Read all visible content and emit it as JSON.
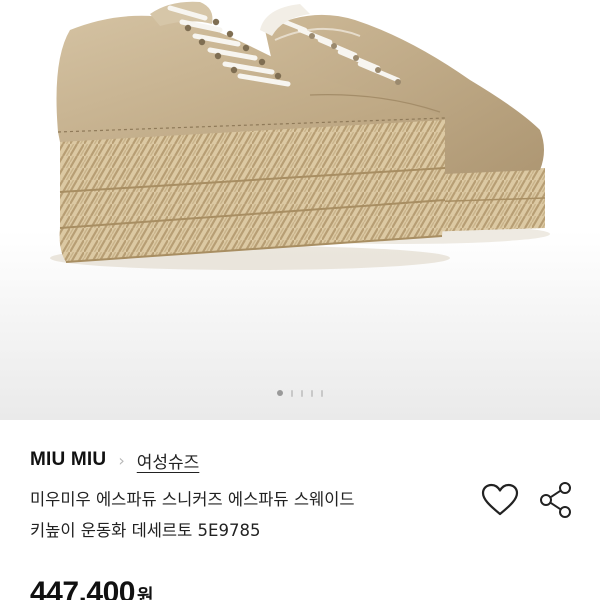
{
  "product": {
    "brand": "MIU MIU",
    "breadcrumb_separator": "›",
    "category": "여성슈즈",
    "title_line1": "미우미우 에스파듀 스니커즈 에스파듀 스웨이드",
    "title_line2": "키높이 운동화 데세르토 5E9785",
    "price": "447,400",
    "price_unit": "원"
  },
  "gallery": {
    "image_alt": "MIU MIU 에스파듀 스니커즈 제품 사진",
    "image_count": 5,
    "active_index": 0
  },
  "icons": {
    "wishlist": "heart-icon",
    "share": "share-icon"
  },
  "colors": {
    "suede": "#c9b595",
    "jute": "#dcc9a3",
    "laces": "#f7f5f0",
    "text": "#222222"
  }
}
